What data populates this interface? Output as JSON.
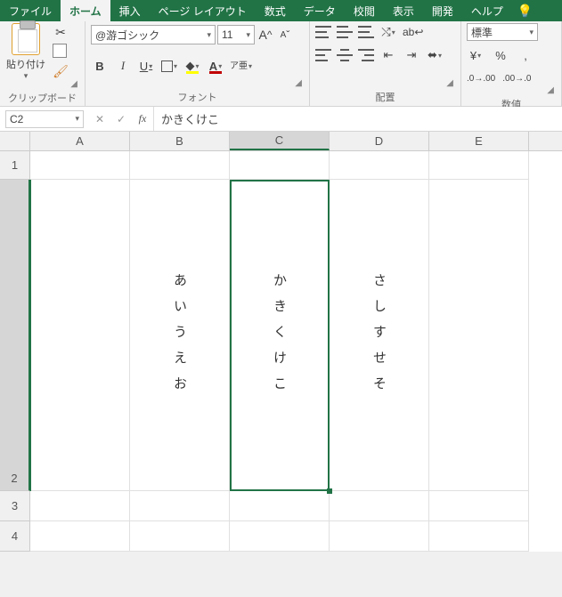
{
  "tabs": {
    "file": "ファイル",
    "home": "ホーム",
    "insert": "挿入",
    "pagelayout": "ページ レイアウト",
    "formulas": "数式",
    "data": "データ",
    "review": "校閲",
    "view": "表示",
    "developer": "開発",
    "help": "ヘルプ"
  },
  "ribbon": {
    "clipboard": {
      "paste": "貼り付け",
      "label": "クリップボード"
    },
    "font": {
      "name": "@游ゴシック",
      "size": "11",
      "grow": "A",
      "shrink": "A",
      "bold": "B",
      "italic": "I",
      "underline": "U",
      "ruby": "ア亜",
      "label": "フォント"
    },
    "align": {
      "label": "配置"
    },
    "number": {
      "format": "標準",
      "label": "数値",
      "percent": "%",
      "comma": ","
    }
  },
  "formula_bar": {
    "name_box": "C2",
    "cancel": "✕",
    "enter": "✓",
    "fx": "fx",
    "value": "かきくけこ"
  },
  "grid": {
    "cols": [
      "A",
      "B",
      "C",
      "D",
      "E"
    ],
    "rows": [
      "1",
      "2",
      "3",
      "4"
    ],
    "r2": {
      "B": "あいうえお",
      "C": "かきくけこ",
      "D": "さしすせそ"
    }
  }
}
